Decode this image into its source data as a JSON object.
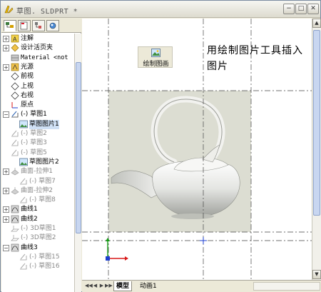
{
  "window": {
    "title": "草图. SLDPRT *",
    "minimize_label": "−",
    "maximize_label": "□",
    "close_label": "✕"
  },
  "left_tabs": [
    "feature-manager",
    "property-manager",
    "configuration-manager",
    "display-manager"
  ],
  "tree": {
    "items": [
      {
        "label": "注解",
        "icon": "annotation-icon",
        "expander": "+",
        "level": 0,
        "dim": false
      },
      {
        "label": "设计活页夹",
        "icon": "design-binder-icon",
        "expander": "+",
        "level": 0,
        "dim": false
      },
      {
        "label": "Material <not",
        "icon": "material-icon",
        "expander": "",
        "level": 0,
        "dim": false,
        "mono": true
      },
      {
        "label": "光源",
        "icon": "lighting-icon",
        "expander": "+",
        "level": 0,
        "dim": false
      },
      {
        "label": "前视",
        "icon": "plane-icon",
        "expander": "",
        "level": 0,
        "dim": false
      },
      {
        "label": "上视",
        "icon": "plane-icon",
        "expander": "",
        "level": 0,
        "dim": false
      },
      {
        "label": "右视",
        "icon": "plane-icon",
        "expander": "",
        "level": 0,
        "dim": false
      },
      {
        "label": "原点",
        "icon": "origin-icon",
        "expander": "",
        "level": 0,
        "dim": false
      },
      {
        "label": "(-) 草图1",
        "icon": "sketch-icon",
        "expander": "−",
        "level": 0,
        "dim": false
      },
      {
        "label": "草图图片1",
        "icon": "sketch-picture-icon",
        "expander": "",
        "level": 1,
        "dim": false,
        "selected": true
      },
      {
        "label": "(-) 草图2",
        "icon": "sketch-icon",
        "expander": "",
        "level": 0,
        "dim": true
      },
      {
        "label": "(-) 草图3",
        "icon": "sketch-icon",
        "expander": "",
        "level": 0,
        "dim": true
      },
      {
        "label": "(-) 草图5",
        "icon": "sketch-icon",
        "expander": "",
        "level": 0,
        "dim": true
      },
      {
        "label": "草图图片2",
        "icon": "sketch-picture-icon",
        "expander": "",
        "level": 1,
        "dim": false
      },
      {
        "label": "曲面-拉伸1",
        "icon": "surface-extrude-icon",
        "expander": "+",
        "level": 0,
        "dim": true
      },
      {
        "label": "(-) 草图7",
        "icon": "sketch-icon",
        "expander": "",
        "level": 1,
        "dim": true
      },
      {
        "label": "曲面-拉伸2",
        "icon": "surface-extrude-icon",
        "expander": "+",
        "level": 0,
        "dim": true
      },
      {
        "label": "(-) 草图8",
        "icon": "sketch-icon",
        "expander": "",
        "level": 1,
        "dim": true
      },
      {
        "label": "曲线1",
        "icon": "curve-icon",
        "expander": "+",
        "level": 0,
        "dim": false
      },
      {
        "label": "曲线2",
        "icon": "curve-icon",
        "expander": "+",
        "level": 0,
        "dim": false
      },
      {
        "label": "(-) 3D草图1",
        "icon": "sketch-3d-icon",
        "expander": "",
        "level": 0,
        "dim": true
      },
      {
        "label": "(-) 3D草图2",
        "icon": "sketch-3d-icon",
        "expander": "",
        "level": 0,
        "dim": true
      },
      {
        "label": "曲线3",
        "icon": "curve-icon",
        "expander": "−",
        "level": 0,
        "dim": false
      },
      {
        "label": "(-) 草图15",
        "icon": "sketch-icon",
        "expander": "",
        "level": 1,
        "dim": true
      },
      {
        "label": "(-) 草图16",
        "icon": "sketch-icon",
        "expander": "",
        "level": 1,
        "dim": true
      }
    ]
  },
  "canvas": {
    "tool_button_label": "绘制图画",
    "annotation": "用绘制图片工具插入图片",
    "axis_x_label": "x",
    "axis_y_label": "y"
  },
  "bottom_tabs": [
    {
      "label": "模型",
      "active": true
    },
    {
      "label": "动画1",
      "active": false
    }
  ],
  "nav_buttons": [
    "◀◀",
    "◀",
    "▶",
    "▶▶"
  ],
  "colors": {
    "accent_selection": "#cfe0f5",
    "axis_red": "#d81818",
    "axis_green": "#139a13",
    "axis_blue": "#1c3fd0",
    "image_background": "#dcddd2"
  }
}
